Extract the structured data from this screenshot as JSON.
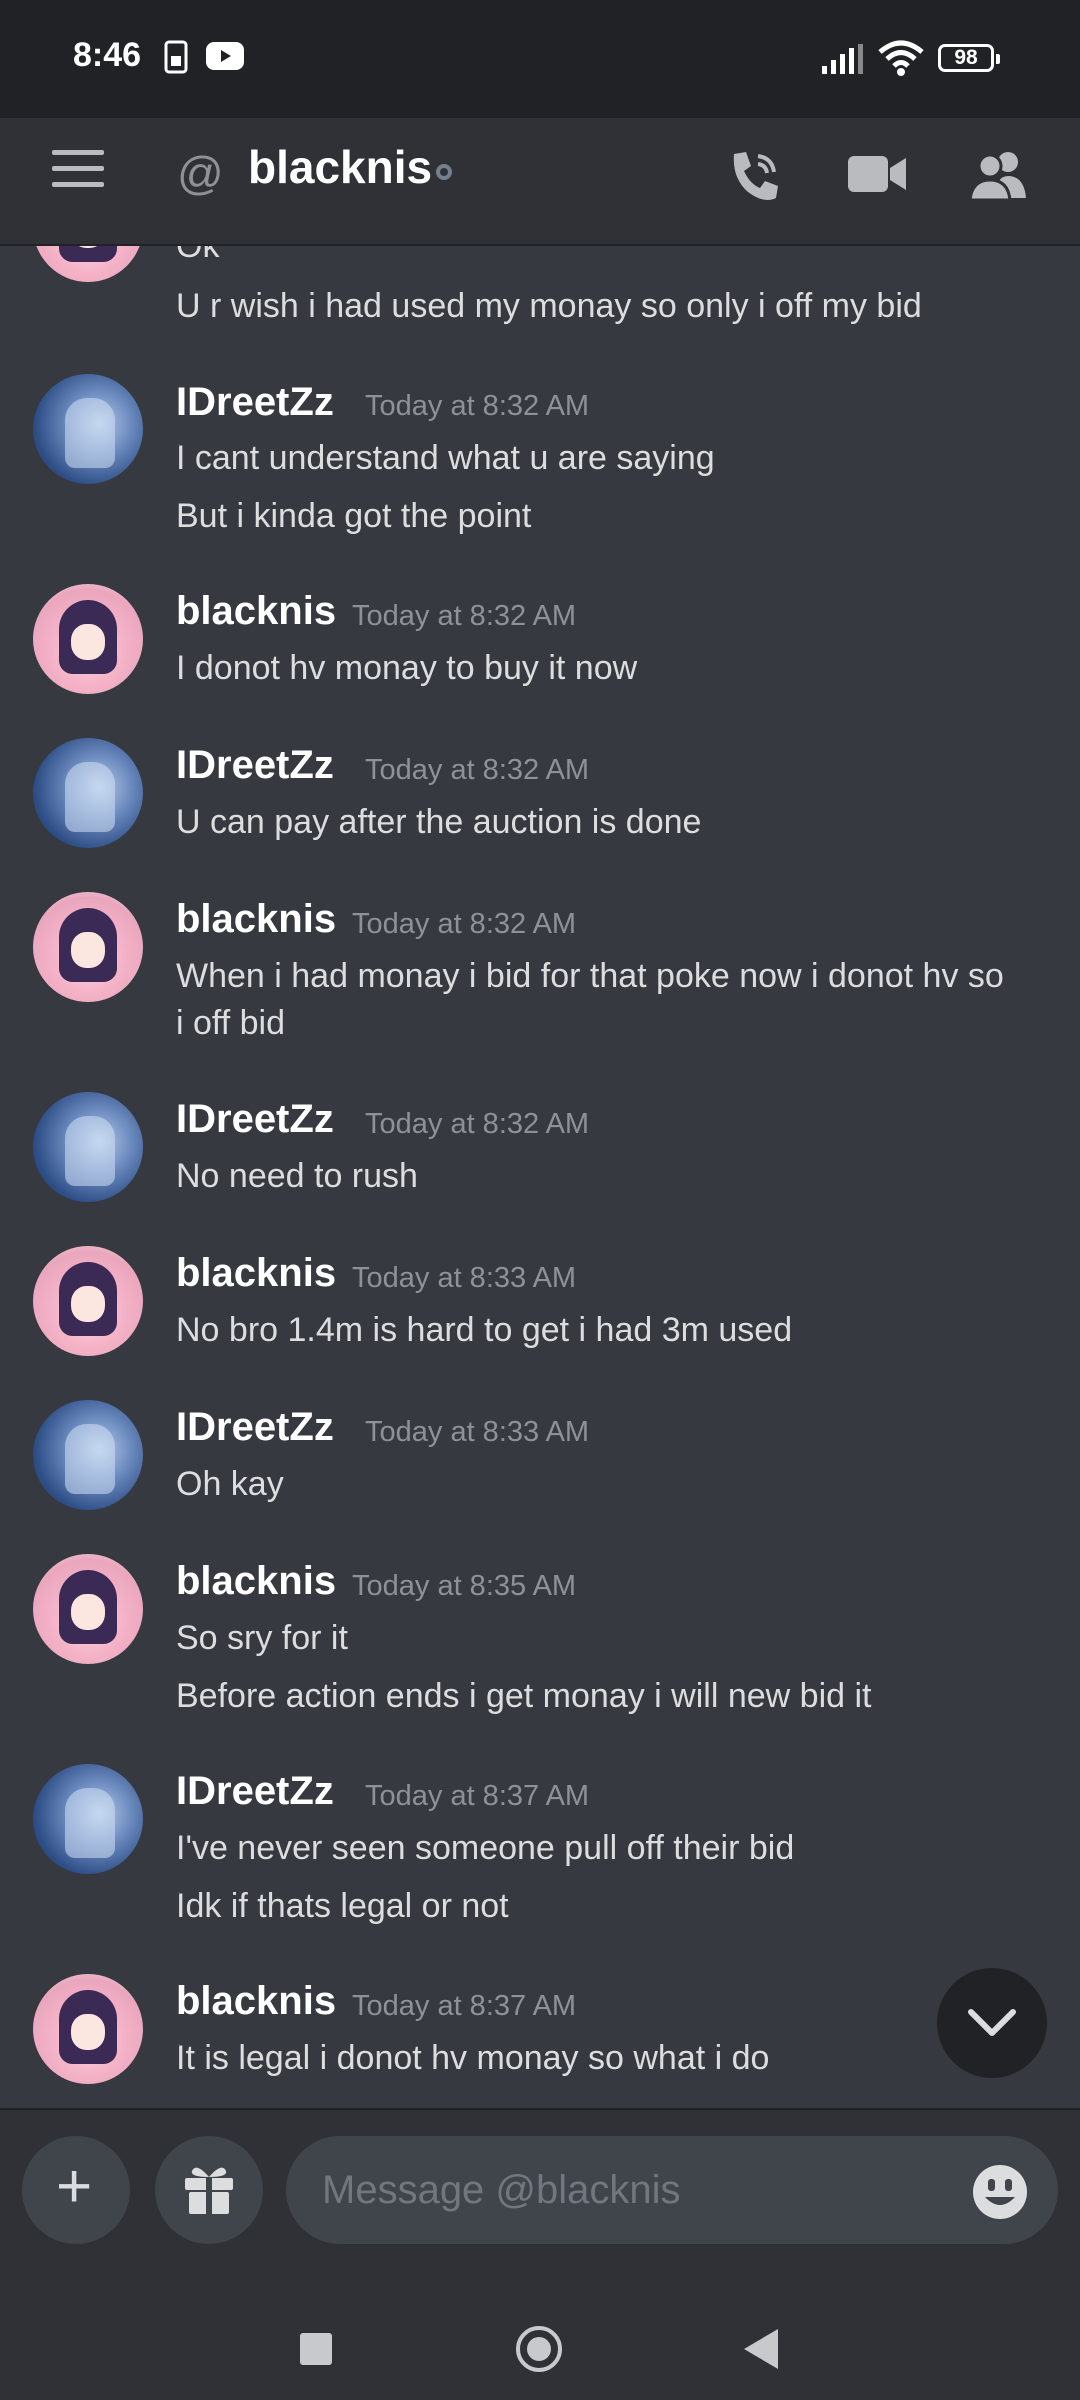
{
  "status_bar": {
    "time": "8:46",
    "battery": "98"
  },
  "header": {
    "channel_name": "blacknis"
  },
  "messages": [
    {
      "lines": [
        "Ok",
        "U r wish i had used my monay so only i off my bid"
      ]
    },
    {
      "author": "IDreetZz",
      "time": "Today at 8:32 AM",
      "lines": [
        "I cant understand what u are saying",
        "But i kinda got the point"
      ]
    },
    {
      "author": "blacknis",
      "time": "Today at 8:32 AM",
      "lines": [
        "I donot hv monay to buy it now"
      ]
    },
    {
      "author": "IDreetZz",
      "time": "Today at 8:32 AM",
      "lines": [
        "U can pay after the auction is done"
      ]
    },
    {
      "author": "blacknis",
      "time": "Today at 8:32 AM",
      "lines": [
        "When i had monay i bid for that poke now i donot hv so",
        "i off bid"
      ]
    },
    {
      "author": "IDreetZz",
      "time": "Today at 8:32 AM",
      "lines": [
        "No need to rush"
      ]
    },
    {
      "author": "blacknis",
      "time": "Today at 8:33 AM",
      "lines": [
        "No bro 1.4m is hard to get i had 3m used"
      ]
    },
    {
      "author": "IDreetZz",
      "time": "Today at 8:33 AM",
      "lines": [
        "Oh kay"
      ]
    },
    {
      "author": "blacknis",
      "time": "Today at 8:35 AM",
      "lines": [
        "So sry for it",
        "Before action ends i get monay i will new bid it"
      ]
    },
    {
      "author": "IDreetZz",
      "time": "Today at 8:37 AM",
      "lines": [
        "I've never seen someone pull off their bid",
        "Idk if thats legal or not"
      ]
    },
    {
      "author": "blacknis",
      "time": "Today at 8:37 AM",
      "lines": [
        "It is legal i donot hv monay so what i do"
      ]
    }
  ],
  "composer": {
    "placeholder": "Message @blacknis"
  },
  "icons": {
    "status_bar": [
      "sim-icon",
      "youtube-icon",
      "signal-icon",
      "wifi-icon",
      "battery-icon"
    ],
    "header": [
      "menu-icon",
      "at-icon",
      "call-icon",
      "video-icon",
      "members-icon"
    ],
    "composer": [
      "plus-icon",
      "gift-icon",
      "emoji-icon"
    ],
    "nav": [
      "recents-icon",
      "home-icon",
      "back-icon"
    ]
  },
  "colors": {
    "background": "#36393f",
    "header": "#2f3136",
    "status_bar": "#202225",
    "input": "#40444b",
    "text": "#dcddde",
    "muted": "#8e9297"
  }
}
